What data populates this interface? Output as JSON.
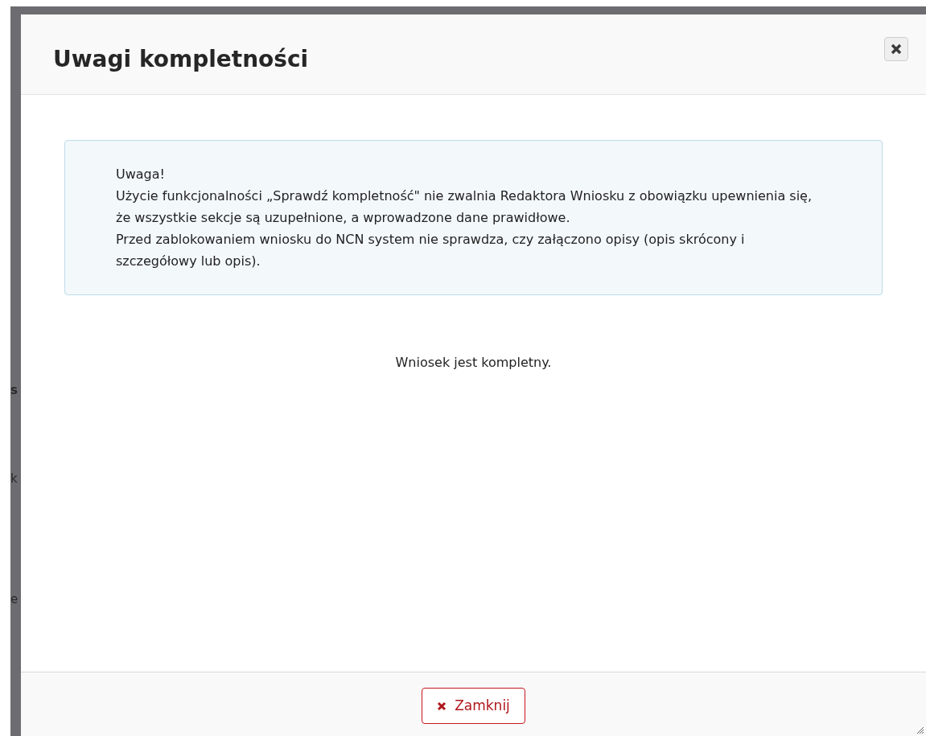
{
  "background_fragments": [
    "s",
    "k",
    "e"
  ],
  "dialog": {
    "title": "Uwagi kompletności",
    "notice": {
      "heading": "Uwaga!",
      "paragraphs": [
        "Użycie funkcjonalności „Sprawdź kompletność\" nie zwalnia Redaktora Wniosku z obowiązku upewnienia się, że wszystkie sekcje są uzupełnione, a wprowadzone dane prawidłowe.",
        "Przed zablokowaniem wniosku do NCN system nie sprawdza, czy załączono opisy (opis skrócony i szczegółowy lub opis)."
      ]
    },
    "result": "Wniosek jest kompletny.",
    "close_button": "Zamknij"
  }
}
